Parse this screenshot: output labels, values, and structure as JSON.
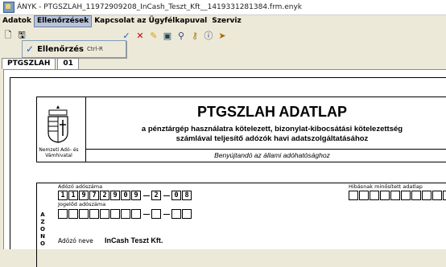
{
  "window": {
    "title": "ÁNYK - PTGSZLAH_11972909208_InCash_Teszt_Kft__1419331281384.frm.enyk"
  },
  "menu": [
    "Adatok",
    "Ellenőrzések",
    "Kapcsolat az Ügyfélkapuval",
    "Szerviz"
  ],
  "toolbar": {
    "icons": [
      "new-form-icon",
      "save-icon",
      "check-icon",
      "delete-icon",
      "highlight-icon",
      "print-icon",
      "attach-icon",
      "key-icon",
      "info-icon",
      "exit-icon"
    ]
  },
  "dropdown": {
    "item_label": "Ellenőrzés",
    "shortcut": "Ctrl-R"
  },
  "tabs": [
    "PTGSZLAH",
    "01"
  ],
  "form": {
    "crest_caption": "Nemzeti Adó- és Vámhivatal",
    "title": "PTGSZLAH ADATLAP",
    "subtitle_line1": "a pénztárgép használatra kötelezett, bizonylat-kibocsátási kötelezettség",
    "subtitle_line2": "számlával teljesítő adózók havi adatszolgáltatásához",
    "benyujtando": "Benyújtandó az állami adóhatósághoz",
    "section_letters": "A Z O N O",
    "tax_number_label": "Adózó adószáma",
    "tax_number_part1": [
      "1",
      "1",
      "9",
      "7",
      "2",
      "9",
      "0",
      "9"
    ],
    "tax_number_part2": [
      "2"
    ],
    "tax_number_part3": [
      "0",
      "8"
    ],
    "group_id_label": "Jogelőd adószáma",
    "error_label": "Hibásnak minősített adatlap",
    "name_label": "Adózó neve",
    "name_value": "InCash Teszt Kft."
  }
}
